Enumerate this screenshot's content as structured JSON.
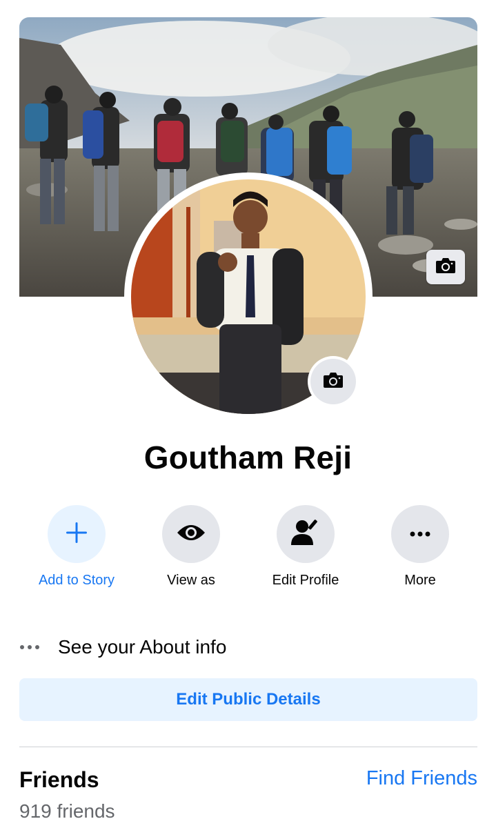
{
  "profile": {
    "name": "Goutham Reji"
  },
  "actions": [
    {
      "label": "Add to Story",
      "icon": "plus-icon"
    },
    {
      "label": "View as",
      "icon": "eye-icon"
    },
    {
      "label": "Edit Profile",
      "icon": "edit-person-icon"
    },
    {
      "label": "More",
      "icon": "more-dots-icon"
    }
  ],
  "about": {
    "label": "See your About info",
    "icon": "more-dots-icon"
  },
  "edit_public": {
    "label": "Edit Public Details"
  },
  "friends": {
    "title": "Friends",
    "find_label": "Find Friends",
    "count_text": "919 friends"
  },
  "colors": {
    "accent": "#1877f2",
    "light_accent_bg": "#e7f3ff",
    "button_bg": "#e4e6eb",
    "secondary_text": "#65676b"
  }
}
